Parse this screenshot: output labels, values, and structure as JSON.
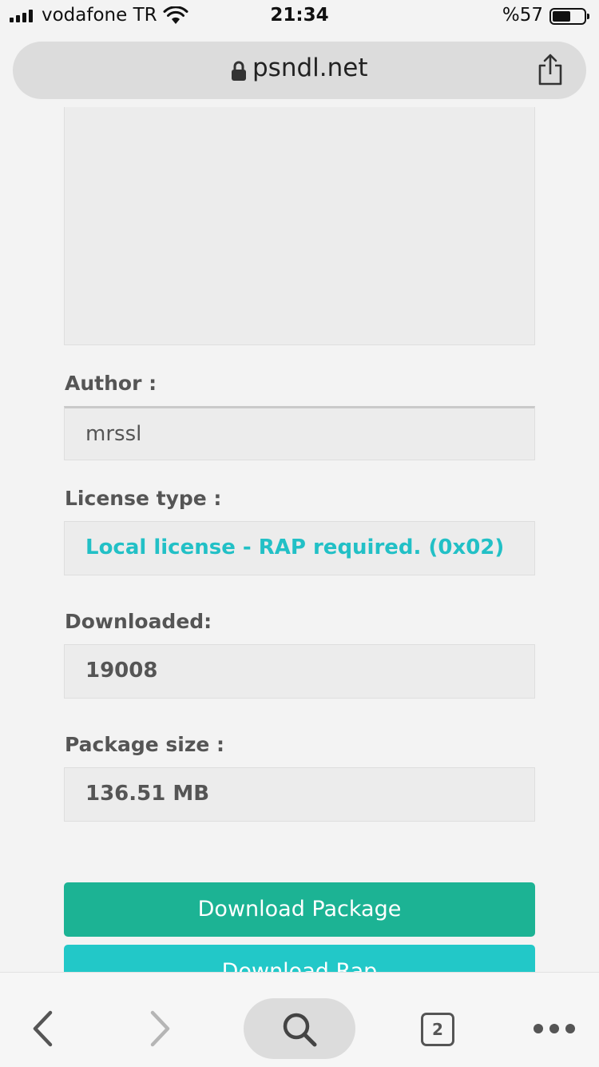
{
  "status_bar": {
    "carrier": "vodafone TR",
    "time": "21:34",
    "battery_percent": "%57",
    "battery_level": 0.57
  },
  "browser": {
    "url": "psndl.net",
    "open_tabs": "2"
  },
  "fields": {
    "author": {
      "label": "Author :",
      "value": "mrssl"
    },
    "license": {
      "label": "License type :",
      "value": "Local license - RAP required. (0x02)"
    },
    "downloaded": {
      "label": "Downloaded:",
      "value": "19008"
    },
    "package_size": {
      "label": "Package size :",
      "value": "136.51 MB"
    }
  },
  "buttons": {
    "download_package": "Download Package",
    "download_rap": "Download Rap"
  },
  "colors": {
    "accent_teal": "#22c0c6",
    "primary_button": "#1cb394",
    "secondary_button": "#22c8c8"
  }
}
